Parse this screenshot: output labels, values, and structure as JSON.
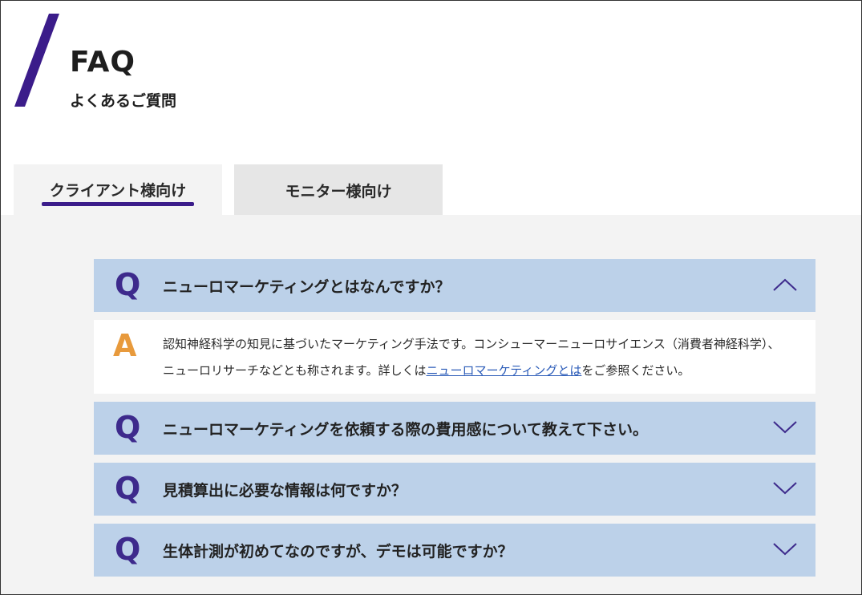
{
  "header": {
    "title": "FAQ",
    "subtitle": "よくあるご質問",
    "accent_color": "#3b1c8a"
  },
  "tabs": [
    {
      "label": "クライアント様向け",
      "active": true
    },
    {
      "label": "モニター様向け",
      "active": false
    }
  ],
  "faq": {
    "q_mark": "Q",
    "a_mark": "A",
    "items": [
      {
        "question": "ニューロマーケティングとはなんですか？",
        "expanded": true,
        "chevron": "chevron-up-icon",
        "answer_before_link": "認知神経科学の知見に基づいたマーケティング手法です。コンシューマーニューロサイエンス（消費者神経科学）、ニューロリサーチなどとも称されます。詳しくは",
        "answer_link": "ニューロマーケティングとは",
        "answer_after_link": "をご参照ください。"
      },
      {
        "question": "ニューロマーケティングを依頼する際の費用感について教えて下さい。",
        "expanded": false,
        "chevron": "chevron-down-icon"
      },
      {
        "question": "見積算出に必要な情報は何ですか？",
        "expanded": false,
        "chevron": "chevron-down-icon"
      },
      {
        "question": "生体計測が初めてなのですが、デモは可能ですか？",
        "expanded": false,
        "chevron": "chevron-down-icon"
      }
    ]
  },
  "colors": {
    "question_bg": "#bcd1e9",
    "q_mark": "#3d2a8c",
    "a_mark": "#e89a3c",
    "link": "#2b5bb8",
    "content_bg": "#f3f3f3"
  }
}
